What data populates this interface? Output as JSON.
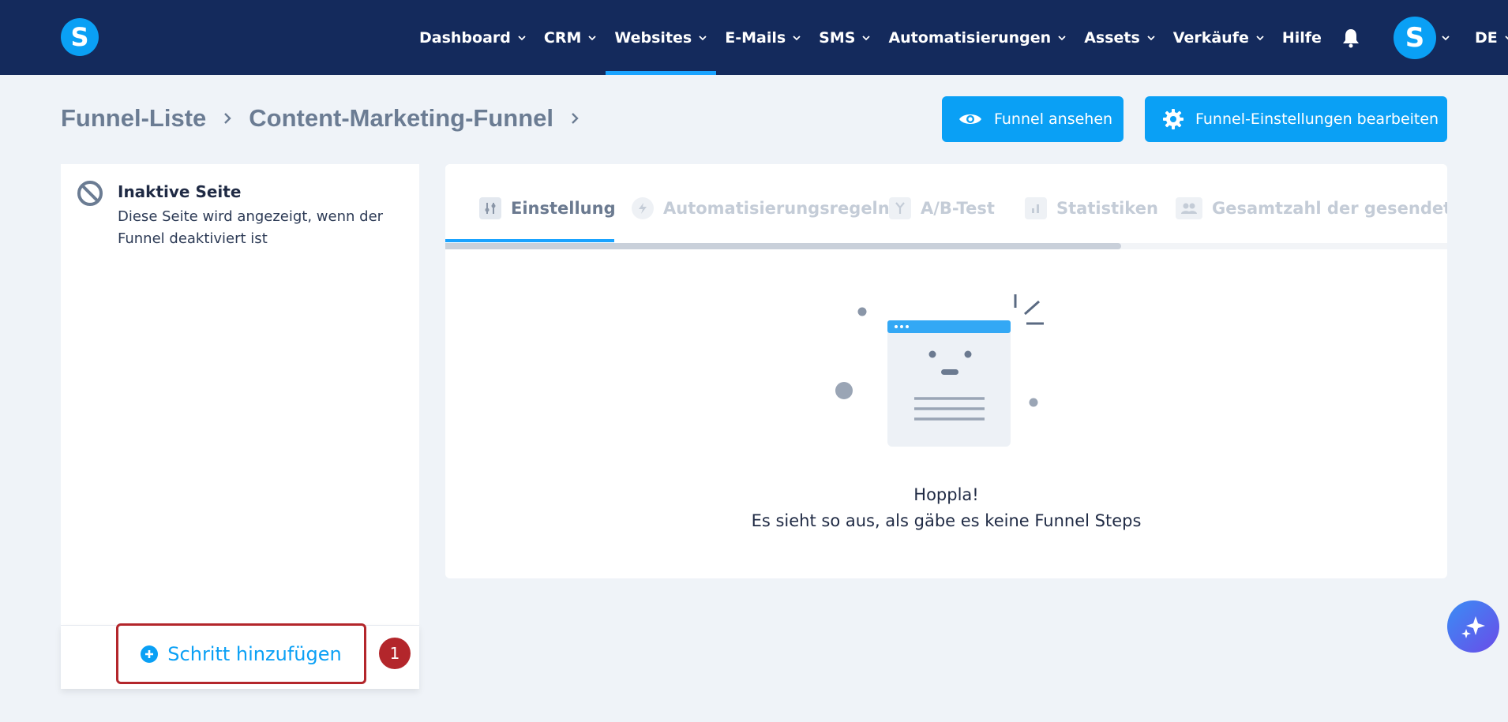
{
  "brand": {
    "logo_letter": "S",
    "accent": "#0aa0f5",
    "nav_bg": "#142a5c",
    "highlight": "#b3262b"
  },
  "nav": {
    "items": [
      {
        "label": "Dashboard",
        "has_dropdown": true
      },
      {
        "label": "CRM",
        "has_dropdown": true
      },
      {
        "label": "Websites",
        "has_dropdown": true,
        "active": true
      },
      {
        "label": "E-Mails",
        "has_dropdown": true
      },
      {
        "label": "SMS",
        "has_dropdown": true
      },
      {
        "label": "Automatisierungen",
        "has_dropdown": true
      },
      {
        "label": "Assets",
        "has_dropdown": true
      },
      {
        "label": "Verkäufe",
        "has_dropdown": true
      },
      {
        "label": "Hilfe",
        "has_dropdown": false
      }
    ],
    "avatar_letter": "S",
    "language": "DE"
  },
  "breadcrumb": {
    "items": [
      "Funnel-Liste",
      "Content-Marketing-Funnel"
    ]
  },
  "actions": {
    "view_funnel": "Funnel ansehen",
    "edit_settings": "Funnel-Einstellungen bearbeiten"
  },
  "left_panel": {
    "inactive_title": "Inaktive Seite",
    "inactive_desc_line1": "Diese Seite wird angezeigt, wenn der",
    "inactive_desc_line2": "Funnel deaktiviert ist",
    "add_step": "Schritt hinzufügen",
    "step_badge": "1"
  },
  "tabs": [
    {
      "label": "Einstellung",
      "icon": "sliders-icon",
      "active": true
    },
    {
      "label": "Automatisierungsregeln",
      "icon": "bolt-icon"
    },
    {
      "label": "A/B-Test",
      "icon": "split-icon"
    },
    {
      "label": "Statistiken",
      "icon": "bar-chart-icon"
    },
    {
      "label": "Gesamtzahl der gesendeten L",
      "icon": "users-icon"
    }
  ],
  "empty_state": {
    "title": "Hoppla!",
    "subtitle": "Es sieht so aus, als gäbe es keine Funnel Steps"
  },
  "fab": {
    "icon": "sparkles-icon"
  }
}
